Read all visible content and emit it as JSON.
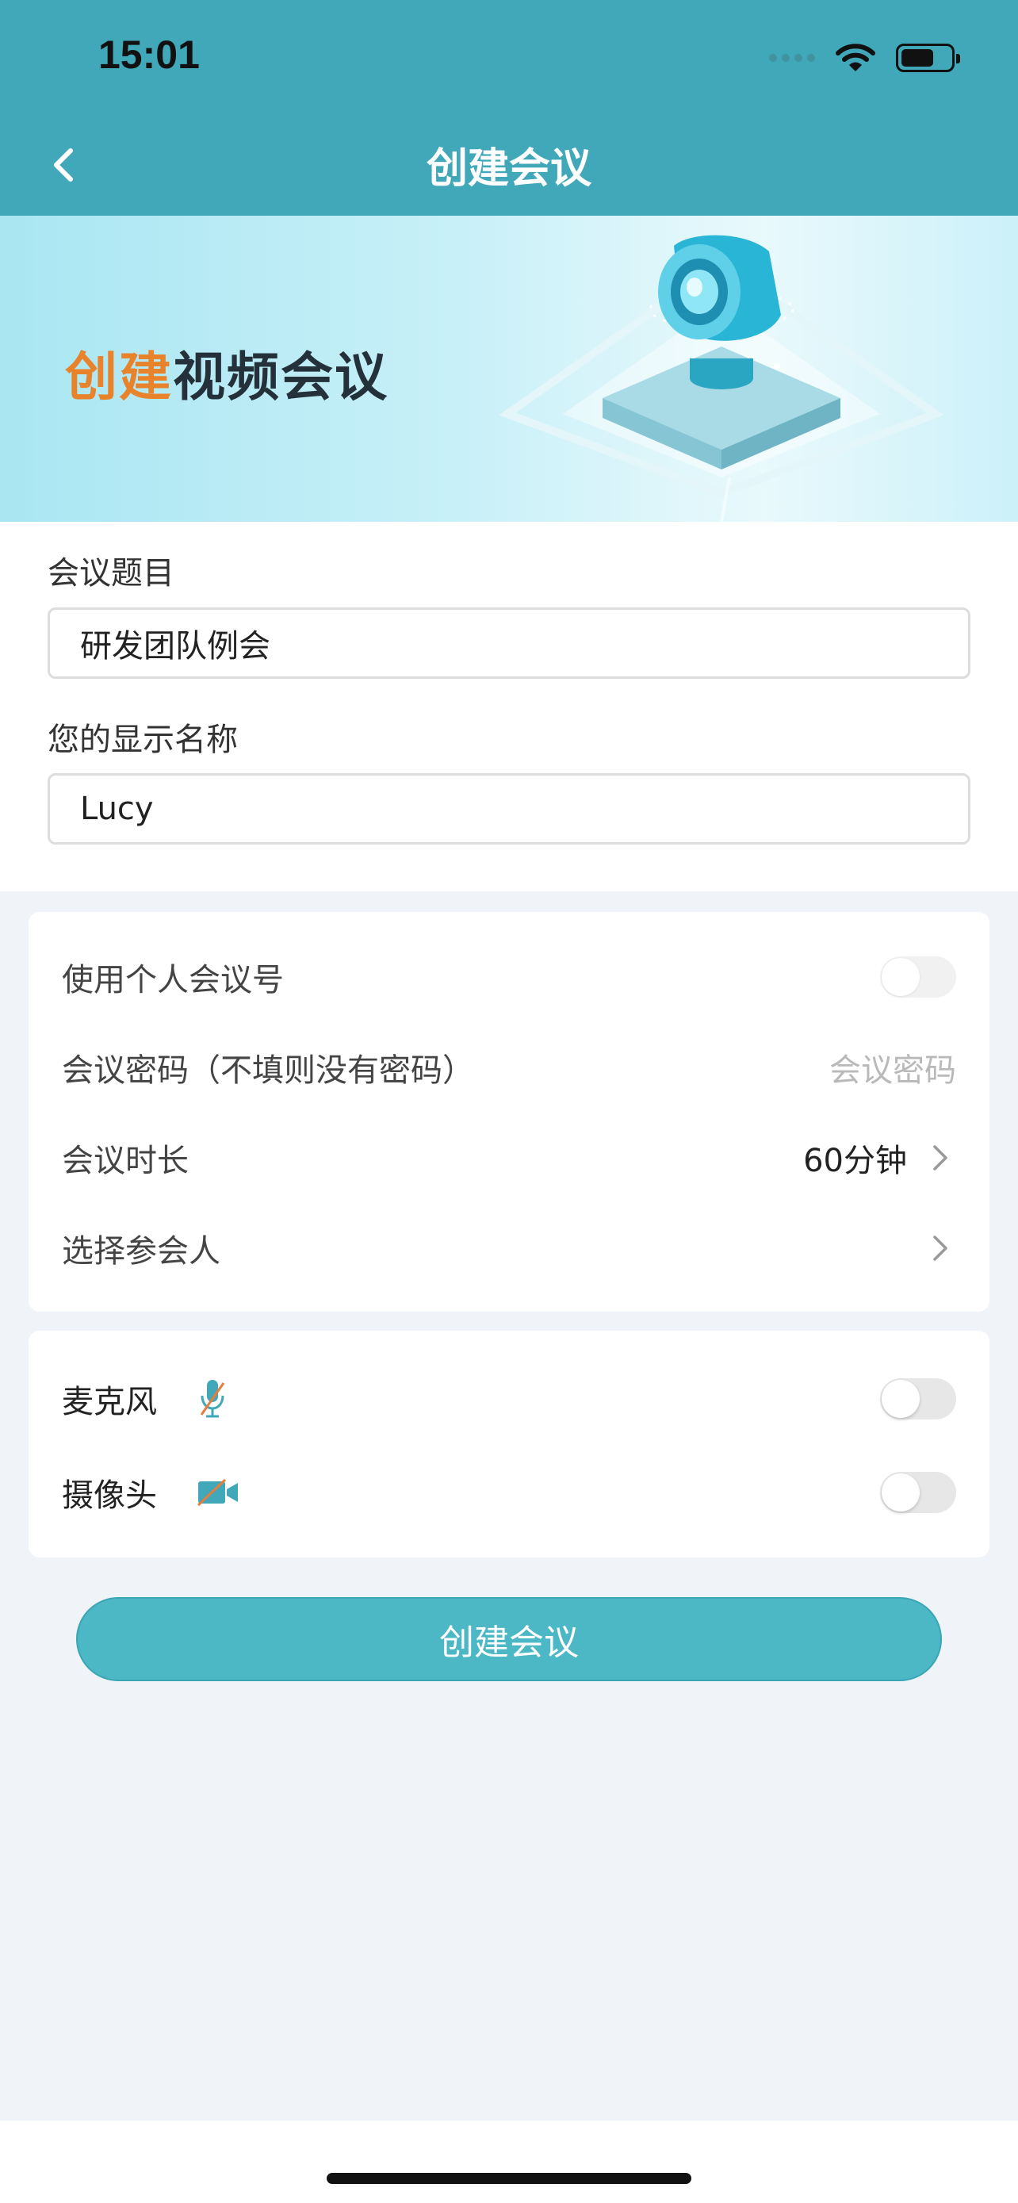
{
  "status_bar": {
    "time": "15:01"
  },
  "nav": {
    "title": "创建会议"
  },
  "banner": {
    "title_accent": "创建",
    "title_rest": "视频会议"
  },
  "form": {
    "topic_label": "会议题目",
    "topic_value": "研发团队例会",
    "name_label": "您的显示名称",
    "name_value": "Lucy"
  },
  "settings": {
    "personal_id_label": "使用个人会议号",
    "personal_id_on": false,
    "password_label": "会议密码（不填则没有密码）",
    "password_placeholder": "会议密码",
    "duration_label": "会议时长",
    "duration_value": "60分钟",
    "participants_label": "选择参会人"
  },
  "devices": {
    "mic_label": "麦克风",
    "mic_on": false,
    "camera_label": "摄像头",
    "camera_on": false
  },
  "actions": {
    "create_label": "创建会议"
  },
  "colors": {
    "header": "#41a8b9",
    "accent_orange": "#e8832c",
    "button": "#4cb7c5",
    "background": "#f0f4f8"
  }
}
